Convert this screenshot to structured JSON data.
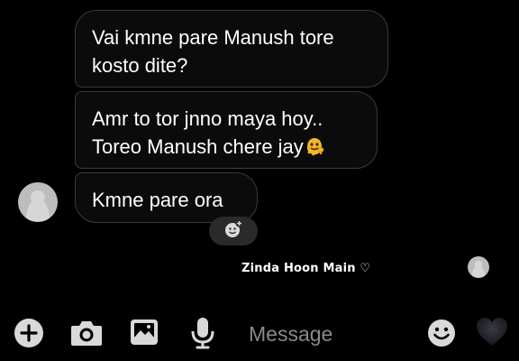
{
  "thread": {
    "messages": [
      {
        "text": "Vai kmne pare Manush tore\nkosto dite?"
      },
      {
        "text": "Amr to tor jnno maya hoy..\nToreo Manush chere jay",
        "emoji": "melting-face"
      },
      {
        "text": "Kmne pare ora"
      }
    ],
    "reaction_button_icon": "add-reaction-icon",
    "seen_status": "Zinda Hoon Main ♡"
  },
  "composer": {
    "placeholder": "Message",
    "icons": [
      "plus-icon",
      "camera-icon",
      "gallery-icon",
      "microphone-icon",
      "emoji-icon",
      "heart-icon"
    ]
  },
  "colors": {
    "background": "#000000",
    "bubble_border": "#3a3a3a",
    "text": "#ffffff",
    "placeholder": "#8a8a8a",
    "icon": "#d9d9d9"
  }
}
